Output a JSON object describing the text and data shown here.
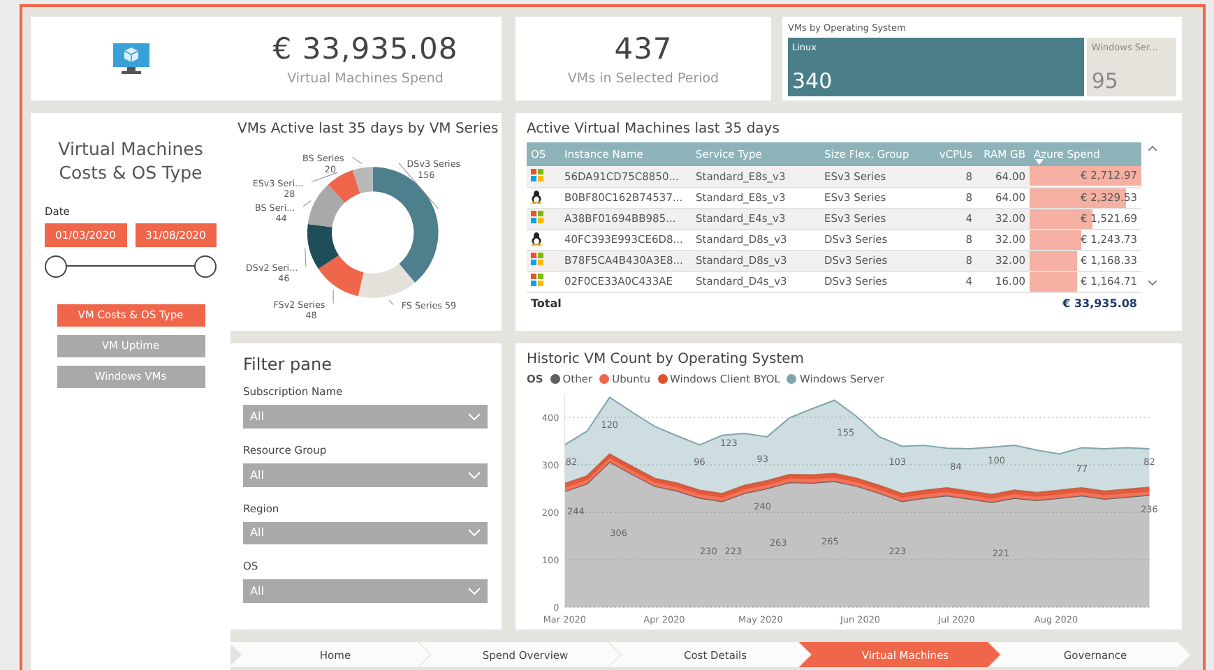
{
  "side_panel": {
    "title": "Virtual Machines Costs & OS Type",
    "date_label": "Date",
    "date_from": "01/03/2020",
    "date_to": "31/08/2020",
    "buttons": [
      {
        "label": "VM Costs & OS Type",
        "selected": true
      },
      {
        "label": "VM Uptime",
        "selected": false
      },
      {
        "label": "Windows VMs",
        "selected": false
      }
    ]
  },
  "kpis": [
    {
      "value": "€ 33,935.08",
      "label": "Virtual Machines Spend"
    },
    {
      "value": "437",
      "label": "VMs in Selected Period"
    }
  ],
  "os_tiles": {
    "title": "VMs by Operating System",
    "tiles": [
      {
        "label": "Linux",
        "value": "340",
        "color": "#4a7f8a"
      },
      {
        "label": "Windows Ser...",
        "value": "95",
        "color": "#e6e3dc"
      }
    ]
  },
  "series_donut": {
    "title": "VMs Active last 35 days by VM Series",
    "chart_data": {
      "type": "donut",
      "categories": [
        "DSv3 Series",
        "FS Series",
        "FSv2 Series",
        "DSv2 Seri...",
        "BS Seri...",
        "ESv3 Seri...",
        "BS Series"
      ],
      "values": [
        156,
        59,
        48,
        46,
        44,
        28,
        20
      ],
      "colors": [
        "#4d7f8d",
        "#e4e1da",
        "#f0664a",
        "#1d4e59",
        "#a9a9a9",
        "#f0664a",
        "#b8b8b8"
      ],
      "data_labels": true
    }
  },
  "vm_table": {
    "title": "Active Virtual Machines last 35 days",
    "columns": [
      {
        "label": "OS",
        "sorted": false
      },
      {
        "label": "Instance Name",
        "sorted": false
      },
      {
        "label": "Service Type",
        "sorted": false
      },
      {
        "label": "Size Flex. Group",
        "sorted": false
      },
      {
        "label": "vCPUs",
        "sorted": false
      },
      {
        "label": "RAM GB",
        "sorted": false
      },
      {
        "label": "Azure Spend",
        "sorted": true
      }
    ],
    "rows": [
      {
        "kind": "windows",
        "instance": "56DA91CD75C8850...",
        "service": "Standard_E8s_v3",
        "group": "ESv3 Series",
        "vcpus": "8",
        "ram": "64.00",
        "spend": "€ 2,712.97",
        "level": 1
      },
      {
        "kind": "linux",
        "instance": "B0BF80C162B74537...",
        "service": "Standard_E8s_v3",
        "group": "ESv3 Series",
        "vcpus": "8",
        "ram": "64.00",
        "spend": "€ 2,329.53",
        "level": 0.86
      },
      {
        "kind": "windows",
        "instance": "A38BF01694BB985...",
        "service": "Standard_E4s_v3",
        "group": "ESv3 Series",
        "vcpus": "4",
        "ram": "32.00",
        "spend": "€ 1,521.69",
        "level": 0.56
      },
      {
        "kind": "linux",
        "instance": "40FC393E993CE6D8...",
        "service": "Standard_D8s_v3",
        "group": "DSv3 Series",
        "vcpus": "8",
        "ram": "32.00",
        "spend": "€ 1,243.73",
        "level": 0.46
      },
      {
        "kind": "windows",
        "instance": "B78F5CA4B430A3E8...",
        "service": "Standard_D8s_v3",
        "group": "DSv3 Series",
        "vcpus": "8",
        "ram": "32.00",
        "spend": "€ 1,168.33",
        "level": 0.43
      },
      {
        "kind": "windows",
        "instance": "02F0CE33A0C433AE",
        "service": "Standard_D4s_v3",
        "group": "DSv3 Series",
        "vcpus": "4",
        "ram": "16.00",
        "spend": "€ 1,164.71",
        "level": 0.43
      }
    ],
    "total_label": "Total",
    "total_value": "€ 33,935.08"
  },
  "filter_pane": {
    "title": "Filter pane",
    "filters": [
      {
        "label": "Subscription Name",
        "value": "All"
      },
      {
        "label": "Resource Group",
        "value": "All"
      },
      {
        "label": "Region",
        "value": "All"
      },
      {
        "label": "OS",
        "value": "All"
      }
    ]
  },
  "history": {
    "title": "Historic VM Count by Operating System",
    "legend_label": "OS",
    "chart_data": {
      "type": "area",
      "stacked": true,
      "x": [
        "2020-03-01",
        "2020-03-08",
        "2020-03-15",
        "2020-03-22",
        "2020-03-29",
        "2020-04-05",
        "2020-04-12",
        "2020-04-19",
        "2020-04-26",
        "2020-05-03",
        "2020-05-10",
        "2020-05-17",
        "2020-05-24",
        "2020-05-31",
        "2020-06-07",
        "2020-06-14",
        "2020-06-21",
        "2020-06-28",
        "2020-07-05",
        "2020-07-12",
        "2020-07-19",
        "2020-07-26",
        "2020-08-02",
        "2020-08-09",
        "2020-08-16",
        "2020-08-23",
        "2020-08-30"
      ],
      "xlim": [
        "2020-03-01",
        "2020-08-30"
      ],
      "xticks": [
        {
          "value": "2020-03-01",
          "label": "Mar 2020"
        },
        {
          "value": "2020-04-01",
          "label": "Apr 2020"
        },
        {
          "value": "2020-05-01",
          "label": "May 2020"
        },
        {
          "value": "2020-06-01",
          "label": "Jun 2020"
        },
        {
          "value": "2020-07-01",
          "label": "Jul 2020"
        },
        {
          "value": "2020-08-01",
          "label": "Aug 2020"
        }
      ],
      "series": [
        {
          "name": "Other",
          "color": "#5f5f5f",
          "values": [
            244,
            260,
            306,
            280,
            255,
            245,
            230,
            223,
            240,
            250,
            263,
            262,
            265,
            255,
            240,
            223,
            230,
            235,
            228,
            221,
            230,
            225,
            230,
            235,
            228,
            232,
            236
          ]
        },
        {
          "name": "Ubuntu",
          "color": "#f0664a",
          "values": [
            9,
            9,
            9,
            9,
            9,
            9,
            9,
            9,
            9,
            9,
            9,
            9,
            9,
            9,
            9,
            9,
            9,
            9,
            9,
            9,
            9,
            9,
            9,
            9,
            9,
            9,
            9
          ]
        },
        {
          "name": "Windows Client BYOL",
          "color": "#e0502e",
          "values": [
            7,
            7,
            7,
            7,
            7,
            7,
            7,
            7,
            7,
            7,
            7,
            7,
            7,
            7,
            7,
            7,
            7,
            7,
            7,
            7,
            7,
            7,
            7,
            7,
            7,
            7,
            7
          ]
        },
        {
          "name": "Windows Server",
          "color": "#7fa5ae",
          "values": [
            82,
            95,
            120,
            115,
            110,
            100,
            96,
            123,
            110,
            93,
            120,
            140,
            155,
            130,
            103,
            100,
            95,
            84,
            90,
            100,
            95,
            90,
            77,
            85,
            90,
            88,
            82
          ]
        }
      ],
      "ylim": [
        0,
        450
      ],
      "yticks": [
        0,
        100,
        200,
        300,
        400
      ],
      "grid": true,
      "annotations": [
        "82",
        "120",
        "96",
        "123",
        "93",
        "155",
        "103",
        "84",
        "100",
        "77",
        "82",
        "244",
        "306",
        "230",
        "223",
        "263",
        "265",
        "240",
        "223",
        "221",
        "236"
      ]
    }
  },
  "nav": [
    {
      "label": "Home",
      "selected": false
    },
    {
      "label": "Spend Overview",
      "selected": false
    },
    {
      "label": "Cost Details",
      "selected": false
    },
    {
      "label": "Virtual Machines",
      "selected": true
    },
    {
      "label": "Governance",
      "selected": false
    }
  ]
}
